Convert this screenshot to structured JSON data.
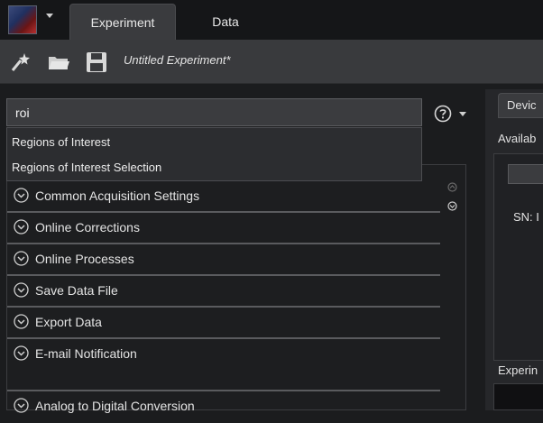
{
  "tabs": {
    "experiment": "Experiment",
    "data": "Data"
  },
  "toolbar": {
    "experiment_title": "Untitled Experiment*"
  },
  "search": {
    "value": "roi",
    "placeholder": ""
  },
  "dropdown": {
    "items": [
      "Regions of Interest",
      "Regions of Interest Selection"
    ]
  },
  "sections": [
    "Common Acquisition Settings",
    "Online Corrections",
    "Online Processes",
    "Save Data File",
    "Export Data",
    "E-mail Notification",
    "Analog to Digital Conversion"
  ],
  "right_panel": {
    "tab_label": "Devic",
    "available_label": "Availab",
    "sn_label": "SN: I",
    "experiment_label": "Experin"
  },
  "icons": {
    "app": "app-logo-icon",
    "new": "new-experiment-wand-icon",
    "open": "open-folder-icon",
    "save": "save-disk-icon",
    "help": "help-question-icon",
    "expand": "expand-chevron-icon"
  },
  "colors": {
    "background": "#1b1c1e",
    "toolbar": "#393a3d",
    "active_tab": "#3a3b3e",
    "text": "#e2e2e2"
  }
}
